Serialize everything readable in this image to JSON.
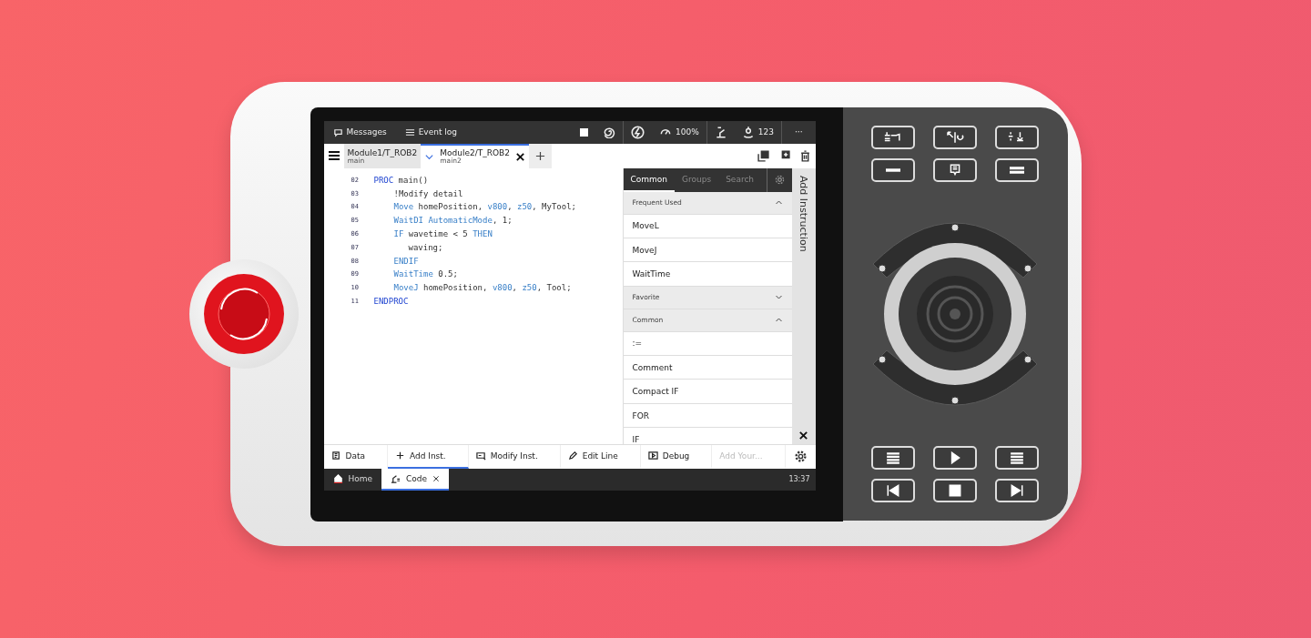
{
  "status_bar": {
    "messages": "Messages",
    "event_log": "Event log",
    "speed": "100%",
    "counter": "123",
    "more": "···"
  },
  "doc_tabs": [
    {
      "title": "Module1/T_ROB2",
      "subtitle": "main",
      "selected": false
    },
    {
      "title": "Module2/T_ROB2",
      "subtitle": "main2",
      "selected": true
    }
  ],
  "code_lines": [
    {
      "number": "02",
      "kind": "top",
      "tokens": [
        {
          "text": "PROC",
          "kind": "keyword"
        },
        {
          "text": " main()",
          "kind": "plain"
        }
      ]
    },
    {
      "number": "03",
      "kind": "body",
      "tokens": [
        {
          "text": "!Modify detail",
          "kind": "plain"
        }
      ]
    },
    {
      "number": "04",
      "kind": "body",
      "tokens": [
        {
          "text": "Move",
          "kind": "instruction"
        },
        {
          "text": " homePosition, ",
          "kind": "plain"
        },
        {
          "text": "v800",
          "kind": "instruction"
        },
        {
          "text": ", ",
          "kind": "plain"
        },
        {
          "text": "z50",
          "kind": "instruction"
        },
        {
          "text": ", MyTool;",
          "kind": "plain"
        }
      ]
    },
    {
      "number": "05",
      "kind": "body",
      "tokens": [
        {
          "text": "WaitDI AutomaticMode",
          "kind": "instruction"
        },
        {
          "text": ", 1;",
          "kind": "plain"
        }
      ]
    },
    {
      "number": "06",
      "kind": "body",
      "tokens": [
        {
          "text": "IF",
          "kind": "instruction"
        },
        {
          "text": " wavetime < 5 ",
          "kind": "plain"
        },
        {
          "text": "THEN",
          "kind": "instruction"
        }
      ]
    },
    {
      "number": "07",
      "kind": "inner",
      "tokens": [
        {
          "text": "waving;",
          "kind": "plain"
        }
      ]
    },
    {
      "number": "08",
      "kind": "body",
      "tokens": [
        {
          "text": "ENDIF",
          "kind": "instruction"
        }
      ]
    },
    {
      "number": "09",
      "kind": "body",
      "tokens": [
        {
          "text": "WaitTime",
          "kind": "instruction"
        },
        {
          "text": " 0.5;",
          "kind": "plain"
        }
      ]
    },
    {
      "number": "10",
      "kind": "body",
      "tokens": [
        {
          "text": "MoveJ",
          "kind": "instruction"
        },
        {
          "text": " homePosition, ",
          "kind": "plain"
        },
        {
          "text": "v800",
          "kind": "instruction"
        },
        {
          "text": ", ",
          "kind": "plain"
        },
        {
          "text": "z50",
          "kind": "instruction"
        },
        {
          "text": ", Tool;",
          "kind": "plain"
        }
      ]
    },
    {
      "number": "11",
      "kind": "top",
      "tokens": [
        {
          "text": "ENDPROC",
          "kind": "keyword"
        }
      ]
    }
  ],
  "panel": {
    "title": "Add Instruction",
    "tabs": [
      {
        "label": "Common",
        "selected": true
      },
      {
        "label": "Groups",
        "selected": false
      },
      {
        "label": "Search",
        "selected": false
      }
    ],
    "rows": [
      {
        "kind": "header",
        "label": "Frequent Used",
        "expanded": true
      },
      {
        "kind": "item",
        "label": "MoveL"
      },
      {
        "kind": "item",
        "label": "MoveJ"
      },
      {
        "kind": "item",
        "label": "WaitTime"
      },
      {
        "kind": "header",
        "label": "Favorite",
        "expanded": false
      },
      {
        "kind": "header",
        "label": "Common",
        "expanded": true
      },
      {
        "kind": "item",
        "label": ":="
      },
      {
        "kind": "item",
        "label": "Comment"
      },
      {
        "kind": "item",
        "label": "Compact IF"
      },
      {
        "kind": "item",
        "label": "FOR"
      },
      {
        "kind": "item",
        "label": "IF"
      }
    ]
  },
  "toolbar": [
    {
      "kind": "data",
      "label": "Data",
      "selected": false,
      "disabled": false
    },
    {
      "kind": "add",
      "label": "Add Inst.",
      "selected": true,
      "disabled": false
    },
    {
      "kind": "modify",
      "label": "Modify Inst.",
      "selected": false,
      "disabled": false
    },
    {
      "kind": "edit",
      "label": "Edit Line",
      "selected": false,
      "disabled": false
    },
    {
      "kind": "debug",
      "label": "Debug",
      "selected": false,
      "disabled": false
    },
    {
      "kind": "custom",
      "label": "Add Your...",
      "selected": false,
      "disabled": true
    }
  ],
  "taskbar": {
    "apps": [
      {
        "kind": "home",
        "label": "Home",
        "selected": false
      },
      {
        "kind": "code",
        "label": "Code",
        "selected": true
      }
    ],
    "time": "13:37"
  }
}
